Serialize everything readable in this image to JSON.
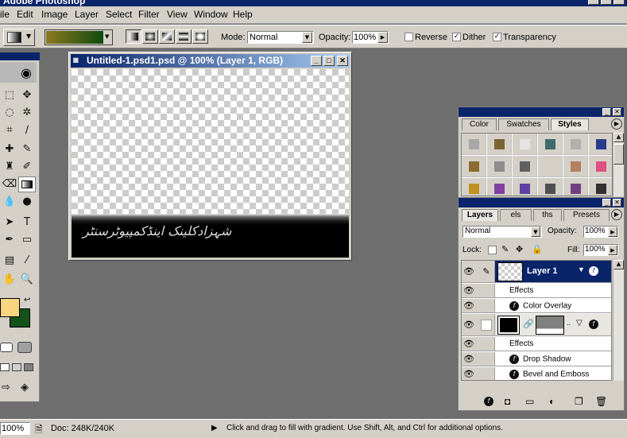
{
  "app": {
    "title": "Adobe Photoshop"
  },
  "menu": [
    "ile",
    "Edit",
    "Image",
    "Layer",
    "Select",
    "Filter",
    "View",
    "Window",
    "Help"
  ],
  "options": {
    "mode_label": "Mode:",
    "mode_value": "Normal",
    "opacity_label": "Opacity:",
    "opacity_value": "100%",
    "reverse_label": "Reverse",
    "dither_label": "Dither",
    "transparency_label": "Transparency",
    "gradient_colors": [
      "#8a7a20",
      "#0f4a0f"
    ]
  },
  "tools": {
    "foreground_color": "#fad580",
    "background_color": "#14521a"
  },
  "document": {
    "title": "Untitled-1.psd1.psd @ 100% (Layer 1, RGB)",
    "banner_text": "شہزادکلینک اینڈکمپیوٹرسنٹر"
  },
  "styles_palette": {
    "tabs": [
      "Color",
      "Swatches",
      "Styles"
    ],
    "active_tab": "Styles",
    "swatches": [
      [
        "#a8a8a8",
        "#7a6434",
        "#e4e4e4",
        "#3e6a6a",
        "#b0b0b0",
        "#2a3a8a"
      ],
      [
        "#8a6a30",
        "#8c8c8c",
        "#606060",
        "#d4d0c8",
        "#b08060",
        "#e05080"
      ],
      [
        "#c09020",
        "#8040a0",
        "#6040a0",
        "#505050",
        "#704080",
        "#303030"
      ]
    ]
  },
  "layers_palette": {
    "tabs": [
      "Layers",
      "els",
      "ths",
      "Presets"
    ],
    "active_tab": "Layers",
    "blend_mode": "Normal",
    "opacity_label": "Opacity:",
    "opacity_value": "100%",
    "lock_label": "Lock:",
    "fill_label": "Fill:",
    "fill_value": "100%",
    "layer1_name": "Layer 1",
    "layer1_effects_label": "Effects",
    "layer1_effect_1": "Color Overlay",
    "layer2_effects_label": "Effects",
    "layer2_effect_1": "Drop Shadow",
    "layer2_effect_2": "Bevel and Emboss"
  },
  "status": {
    "zoom": "100%",
    "doc": "Doc: 248K/240K",
    "hint": "Click and drag to fill with gradient. Use Shift, Alt, and Ctrl for additional options."
  }
}
